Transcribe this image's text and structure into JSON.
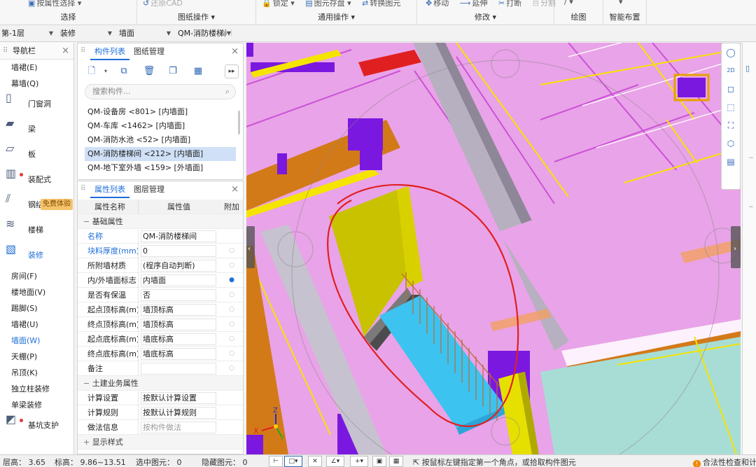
{
  "ribbon": {
    "groups": [
      {
        "title": "选择",
        "items": [
          "按属性选择 ▾"
        ]
      },
      {
        "title": "图纸操作 ▾",
        "items": [
          "还原CAD"
        ]
      },
      {
        "title": "通用操作 ▾",
        "items": [
          "锁定 ▾",
          "图元存盘 ▾",
          "转换图元"
        ]
      },
      {
        "title": "修改 ▾",
        "items": [
          "移动",
          "延伸",
          "打断",
          "分割"
        ]
      },
      {
        "title": "绘图",
        "items": [
          "/ ▾"
        ]
      },
      {
        "title": "智能布置",
        "items": [
          "▾"
        ]
      }
    ]
  },
  "selectors": {
    "floor": "第-1层",
    "category": "装修",
    "type": "墙面",
    "component": "QM-消防楼梯间"
  },
  "nav": {
    "title": "导航栏",
    "top_items": [
      "墙裙(E)",
      "幕墙(Q)"
    ],
    "categories": [
      {
        "label": "门窗洞",
        "icon": "door-window-icon"
      },
      {
        "label": "梁",
        "icon": "beam-icon"
      },
      {
        "label": "板",
        "icon": "slab-icon"
      },
      {
        "label": "装配式",
        "icon": "prefab-icon",
        "dot": true
      },
      {
        "label": "钢结构",
        "icon": "steel-icon",
        "badge": "免费体验"
      },
      {
        "label": "楼梯",
        "icon": "stairs-icon"
      },
      {
        "label": "装修",
        "icon": "decoration-icon",
        "active": true
      }
    ],
    "sub_items": [
      "房间(F)",
      "楼地面(V)",
      "踢脚(S)",
      "墙裙(U)",
      "墙面(W)",
      "天棚(P)",
      "吊顶(K)",
      "独立柱装修",
      "单梁装修"
    ],
    "active_sub": "墙面(W)",
    "bottom_category": {
      "label": "基坑支护",
      "icon": "excavation-icon",
      "dot": true
    }
  },
  "component_panel": {
    "tabs": [
      "构件列表",
      "图纸管理"
    ],
    "active_tab": "构件列表",
    "search_placeholder": "搜索构件...",
    "items": [
      "QM-设备房 <801> [内墙面]",
      "QM-车库 <1462> [内墙面]",
      "QM-消防水池 <52> [内墙面]",
      "QM-消防楼梯间 <212> [内墙面]",
      "QM-地下室外墙 <159> [外墙面]"
    ],
    "selected_index": 3
  },
  "property_panel": {
    "tabs": [
      "属性列表",
      "图层管理"
    ],
    "active_tab": "属性列表",
    "headers": [
      "属性名称",
      "属性值",
      "附加"
    ],
    "groups": [
      {
        "title": "基础属性",
        "rows": [
          {
            "name": "名称",
            "value": "QM-消防楼梯间",
            "blue": true,
            "attach": ""
          },
          {
            "name": "块料厚度(mm)",
            "value": "0",
            "blue": true,
            "attach": "○"
          },
          {
            "name": "所附墙材质",
            "value": "(程序自动判断)",
            "attach": "○"
          },
          {
            "name": "内/外墙面标志",
            "value": "内墙面",
            "attach": "●"
          },
          {
            "name": "是否有保温",
            "value": "否",
            "attach": "○"
          },
          {
            "name": "起点顶标高(m)",
            "value": "墙顶标高",
            "attach": "○"
          },
          {
            "name": "终点顶标高(m)",
            "value": "墙顶标高",
            "attach": "○"
          },
          {
            "name": "起点底标高(m)",
            "value": "墙底标高",
            "attach": "○"
          },
          {
            "name": "终点底标高(m)",
            "value": "墙底标高",
            "attach": "○"
          },
          {
            "name": "备注",
            "value": "",
            "attach": "○"
          }
        ]
      },
      {
        "title": "土建业务属性",
        "rows": [
          {
            "name": "计算设置",
            "value": "按默认计算设置",
            "attach": ""
          },
          {
            "name": "计算规则",
            "value": "按默认计算规则",
            "attach": ""
          },
          {
            "name": "做法信息",
            "value": "按构件做法",
            "placeholder": true,
            "attach": ""
          }
        ]
      },
      {
        "title": "显示样式",
        "rows": []
      }
    ]
  },
  "viewport": {
    "axis_labels": [
      "X",
      "Y",
      "Z"
    ],
    "toolbar": [
      "2D"
    ]
  },
  "status": {
    "floor_height": "层高： 3.65",
    "elevation": "标高： 9.86~13.51",
    "selected": "选中图元： 0",
    "hidden": "隐藏图元： 0",
    "hint": "按鼠标左键指定第一个角点，或拾取构件图元",
    "check": "合法性检查和计"
  },
  "colors": {
    "accent": "#1e6ed8",
    "floor_pink": "#e9a3e8",
    "wall_purple": "#7a18e0",
    "wall_yellow": "#c8c200",
    "water_cyan": "#3cc3f0",
    "markup_red": "#e02020"
  }
}
